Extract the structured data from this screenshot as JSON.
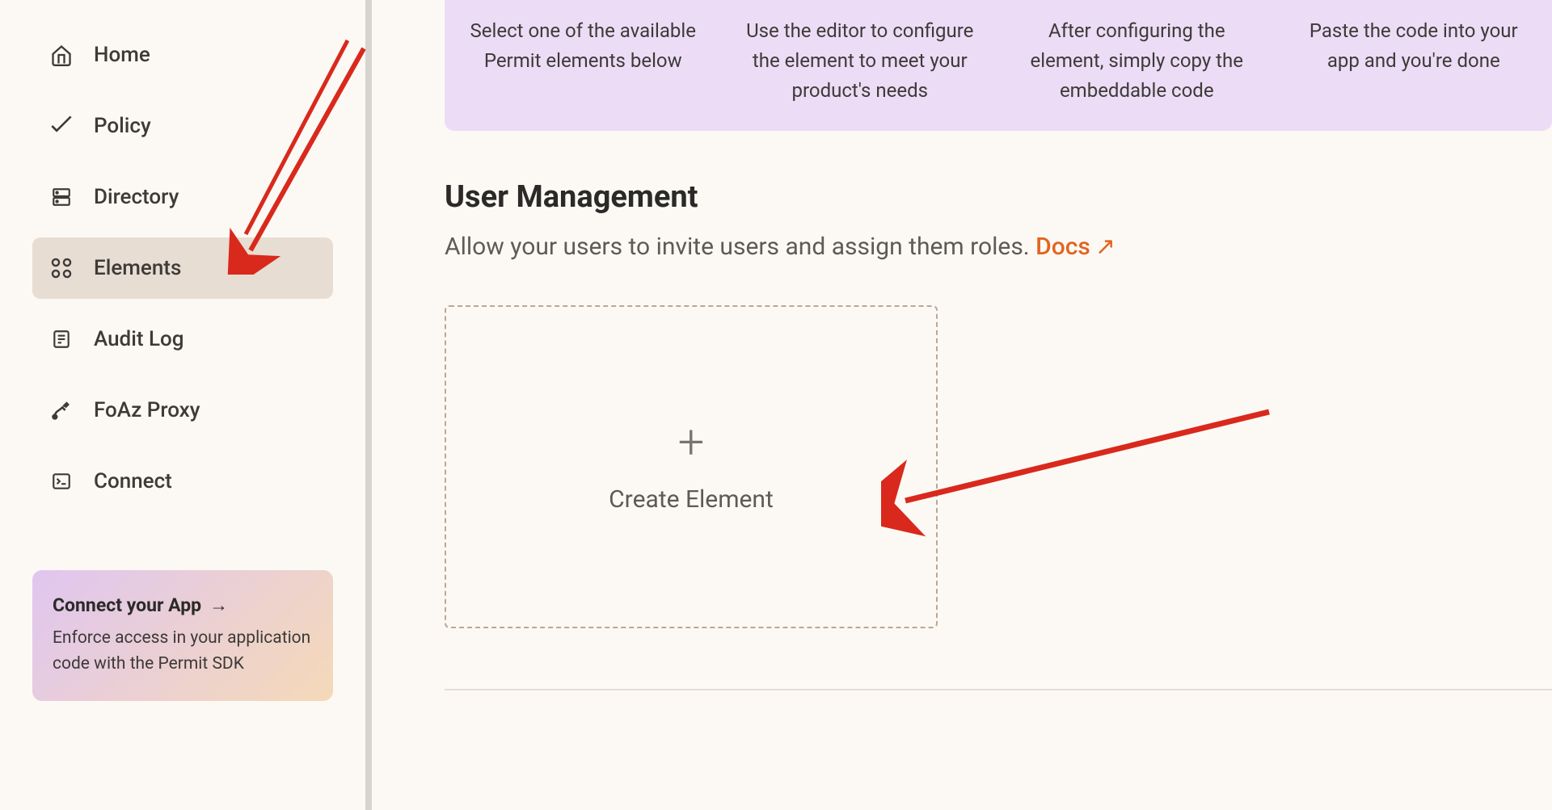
{
  "sidebar": {
    "items": [
      {
        "label": "Home",
        "icon": "home-icon"
      },
      {
        "label": "Policy",
        "icon": "policy-icon"
      },
      {
        "label": "Directory",
        "icon": "directory-icon"
      },
      {
        "label": "Elements",
        "icon": "elements-icon"
      },
      {
        "label": "Audit Log",
        "icon": "audit-log-icon"
      },
      {
        "label": "FoAz Proxy",
        "icon": "foaz-proxy-icon"
      },
      {
        "label": "Connect",
        "icon": "connect-icon"
      }
    ],
    "active_index": 3,
    "connect_card": {
      "title": "Connect your App",
      "arrow": "→",
      "desc": "Enforce access in your application code with the Permit SDK"
    }
  },
  "main": {
    "steps": [
      "Select one of the available Permit elements below",
      "Use the editor to configure the element to meet your product's needs",
      "After configuring the element, simply copy the embeddable code",
      "Paste the code into your app and you're done"
    ],
    "section": {
      "title": "User Management",
      "desc": "Allow your users to invite users and assign them roles. ",
      "docs_label": "Docs",
      "docs_arrow": "↗"
    },
    "create_card": {
      "label": "Create Element"
    }
  }
}
